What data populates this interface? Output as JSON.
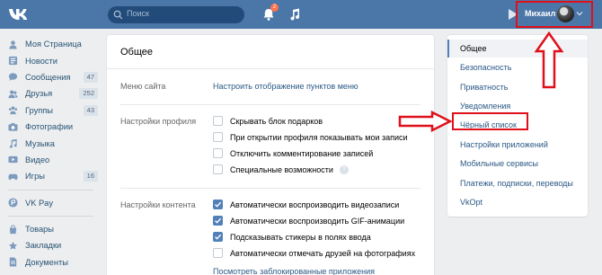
{
  "header": {
    "search_placeholder": "Поиск",
    "notification_count": "2",
    "user_name": "Михаил",
    "brand_color": "#4a76a8"
  },
  "icons": [
    "vk-logo-icon",
    "search-icon",
    "bell-icon",
    "music-icon",
    "play-icon",
    "chevron-down-icon"
  ],
  "leftnav": {
    "items": [
      {
        "label": "Моя Страница",
        "icon": "home-icon"
      },
      {
        "label": "Новости",
        "icon": "news-icon"
      },
      {
        "label": "Сообщения",
        "icon": "messages-icon",
        "count": "47"
      },
      {
        "label": "Друзья",
        "icon": "friends-icon",
        "count": "252"
      },
      {
        "label": "Группы",
        "icon": "groups-icon",
        "count": "43"
      },
      {
        "label": "Фотографии",
        "icon": "photo-icon"
      },
      {
        "label": "Музыка",
        "icon": "music-icon"
      },
      {
        "label": "Видео",
        "icon": "video-icon"
      },
      {
        "label": "Игры",
        "icon": "games-icon",
        "count": "16"
      }
    ],
    "pay": {
      "label": "VK Pay",
      "icon": "vkpay-icon"
    },
    "more": [
      {
        "label": "Товары",
        "icon": "goods-icon"
      },
      {
        "label": "Закладки",
        "icon": "bookmarks-icon"
      },
      {
        "label": "Документы",
        "icon": "documents-icon"
      }
    ]
  },
  "main": {
    "title": "Общее",
    "menu_label": "Меню сайта",
    "menu_link": "Настроить отображение пунктов меню",
    "profile_label": "Настройки профиля",
    "profile_options": [
      {
        "label": "Скрывать блок подарков",
        "checked": false
      },
      {
        "label": "При открытии профиля показывать мои записи",
        "checked": false
      },
      {
        "label": "Отключить комментирование записей",
        "checked": false
      },
      {
        "label": "Специальные возможности",
        "checked": false,
        "help": "?"
      }
    ],
    "content_label": "Настройки контента",
    "content_options": [
      {
        "label": "Автоматически воспроизводить видеозаписи",
        "checked": true
      },
      {
        "label": "Автоматически воспроизводить GIF-анимации",
        "checked": true
      },
      {
        "label": "Подсказывать стикеры в полях ввода",
        "checked": true
      },
      {
        "label": "Автоматически отмечать друзей на фотографиях",
        "checked": false
      }
    ],
    "blocked_apps_link": "Посмотреть заблокированные приложения"
  },
  "rightmenu": {
    "items": [
      {
        "label": "Общее",
        "active": true
      },
      {
        "label": "Безопасность"
      },
      {
        "label": "Приватность"
      },
      {
        "label": "Уведомления"
      },
      {
        "label": "Чёрный список",
        "highlighted": true
      },
      {
        "label": "Настройки приложений"
      },
      {
        "label": "Мобильные сервисы"
      },
      {
        "label": "Платежи, подписки, переводы"
      },
      {
        "label": "VkOpt"
      }
    ]
  },
  "annotation_color": "#e0101a"
}
